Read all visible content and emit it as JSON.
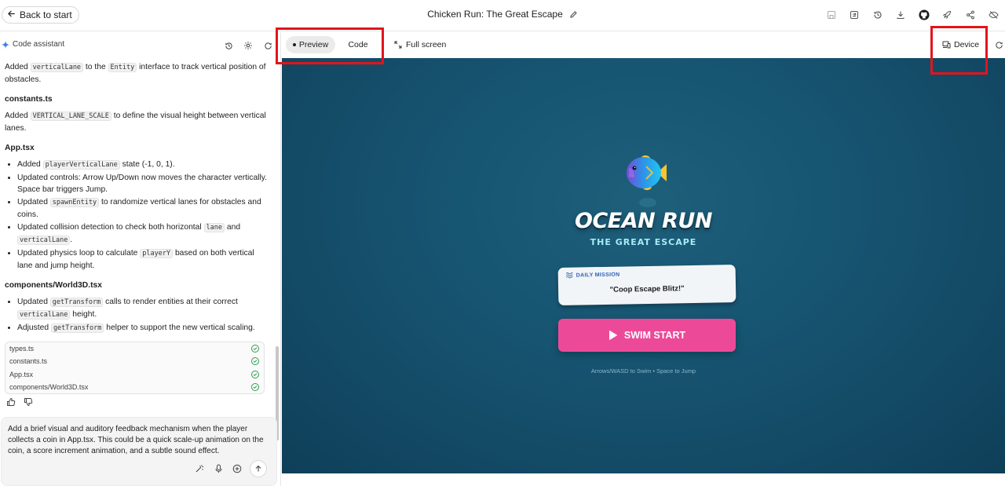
{
  "header": {
    "back_label": "Back to start",
    "title": "Chicken Run: The Great Escape",
    "icons": [
      "save-icon",
      "sync-icon",
      "history-icon",
      "download-icon",
      "github-icon",
      "deploy-icon",
      "share-icon",
      "hide-icon"
    ]
  },
  "assistant": {
    "label": "Code assistant",
    "intro": {
      "a": "Added ",
      "code1": "verticalLane",
      "b": " to the ",
      "code2": "Entity",
      "c": " interface to track vertical position of obstacles."
    },
    "s1": {
      "heading": "constants.ts",
      "a": "Added ",
      "code1": "VERTICAL_LANE_SCALE",
      "b": " to define the visual height between vertical lanes."
    },
    "s2": {
      "heading": "App.tsx",
      "li1": {
        "a": "Added ",
        "code1": "playerVerticalLane",
        "b": " state (-1, 0, 1)."
      },
      "li2": "Updated controls: Arrow Up/Down now moves the character vertically. Space bar triggers Jump.",
      "li3": {
        "a": "Updated ",
        "code1": "spawnEntity",
        "b": " to randomize vertical lanes for obstacles and coins."
      },
      "li4": {
        "a": "Updated collision detection to check both horizontal ",
        "code1": "lane",
        "b": " and ",
        "code2": "verticalLane",
        "c": "."
      },
      "li5": {
        "a": "Updated physics loop to calculate ",
        "code1": "playerY",
        "b": " based on both vertical lane and jump height."
      }
    },
    "s3": {
      "heading": "components/World3D.tsx",
      "li1": {
        "a": "Updated ",
        "code1": "getTransform",
        "b": " calls to render entities at their correct ",
        "code2": "verticalLane",
        "c": " height."
      },
      "li2": {
        "a": "Adjusted ",
        "code1": "getTransform",
        "b": " helper to support the new vertical scaling."
      }
    },
    "files": [
      "types.ts",
      "constants.ts",
      "App.tsx",
      "components/World3D.tsx"
    ],
    "composer_text": "Add a brief visual and auditory feedback mechanism when the player collects a coin in App.tsx. This could be a quick scale-up animation on the coin, a score increment animation, and a subtle sound effect."
  },
  "preview_toolbar": {
    "preview_label": "Preview",
    "code_label": "Code",
    "fullscreen_label": "Full screen",
    "device_label": "Device"
  },
  "game": {
    "logo": "OCEAN RUN",
    "subtitle": "THE GREAT ESCAPE",
    "mission_label": "DAILY MISSION",
    "mission_text": "\"Coop Escape Blitz!\"",
    "start_label": "SWIM START",
    "hint": "Arrows/WASD to Swim • Space to Jump"
  },
  "colors": {
    "accent_red": "#e3141b",
    "game_bg": "#175673",
    "start_button": "#ec4a99",
    "subtitle": "#a6ecf5"
  }
}
